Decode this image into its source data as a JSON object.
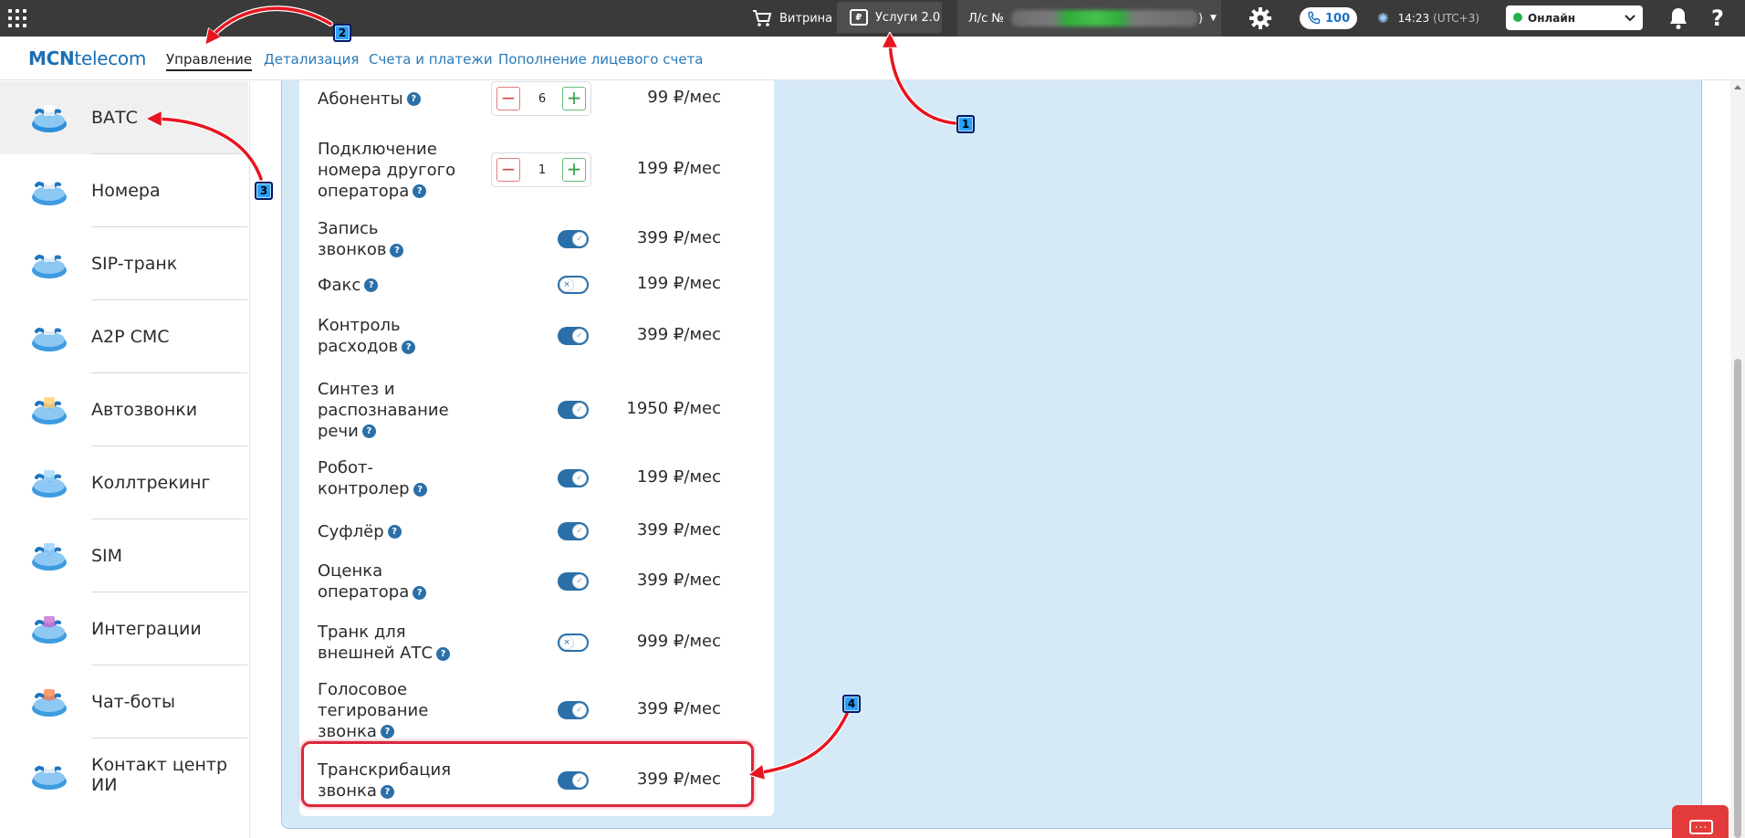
{
  "topbar": {
    "vitrina_label": "Витрина",
    "uslugi_label": "Услуги 2.0",
    "account_prefix": "Л/с №",
    "account_suffix": ")",
    "calls_count": "100",
    "time": "14:23",
    "timezone": "(UTC+3)",
    "status_value": "Онлайн",
    "help_label": "?"
  },
  "nav": {
    "logo_bold": "MCN",
    "logo_rest": "telecom",
    "links": [
      "Управление",
      "Детализация",
      "Счета и платежи",
      "Пополнение лицевого счета"
    ],
    "active_link": "Управление"
  },
  "sidebar": {
    "items": [
      {
        "label": "ВАТС",
        "icon": "vats-icon"
      },
      {
        "label": "Номера",
        "icon": "numbers-icon"
      },
      {
        "label": "SIP-транк",
        "icon": "sip-trunk-icon"
      },
      {
        "label": "A2P СМС",
        "icon": "sms-icon"
      },
      {
        "label": "Автозвонки",
        "icon": "autocall-icon"
      },
      {
        "label": "Коллтрекинг",
        "icon": "calltracking-icon"
      },
      {
        "label": "SIM",
        "icon": "sim-icon"
      },
      {
        "label": "Интеграции",
        "icon": "integrations-icon"
      },
      {
        "label": "Чат-боты",
        "icon": "chatbots-icon"
      },
      {
        "label": "Контакт центр ИИ",
        "icon": "ai-contact-center-icon"
      }
    ],
    "active": "ВАТС"
  },
  "options": [
    {
      "label_lines": [
        "Абоненты"
      ],
      "control": "stepper",
      "value": "6",
      "price": "99 ₽/мес"
    },
    {
      "label_lines": [
        "Подключение",
        "номера другого",
        "оператора"
      ],
      "control": "stepper",
      "value": "1",
      "price": "199 ₽/мес"
    },
    {
      "label_lines": [
        "Запись",
        "звонков"
      ],
      "control": "toggle",
      "state": "on",
      "price": "399 ₽/мес"
    },
    {
      "label_lines": [
        "Факс"
      ],
      "control": "toggle",
      "state": "off",
      "price": "199 ₽/мес"
    },
    {
      "label_lines": [
        "Контроль",
        "расходов"
      ],
      "control": "toggle",
      "state": "on",
      "price": "399 ₽/мес"
    },
    {
      "label_lines": [
        "Синтез и",
        "распознавание",
        "речи"
      ],
      "control": "toggle",
      "state": "on",
      "price": "1950 ₽/мес"
    },
    {
      "label_lines": [
        "Робот-",
        "контролер"
      ],
      "control": "toggle",
      "state": "on",
      "price": "199 ₽/мес"
    },
    {
      "label_lines": [
        "Суфлёр"
      ],
      "control": "toggle",
      "state": "on",
      "price": "399 ₽/мес"
    },
    {
      "label_lines": [
        "Оценка",
        "оператора"
      ],
      "control": "toggle",
      "state": "on",
      "price": "399 ₽/мес"
    },
    {
      "label_lines": [
        "Транк для",
        "внешней АТС"
      ],
      "control": "toggle",
      "state": "off",
      "price": "999 ₽/мес"
    },
    {
      "label_lines": [
        "Голосовое",
        "тегирование",
        "звонка"
      ],
      "control": "toggle",
      "state": "on",
      "price": "399 ₽/мес"
    },
    {
      "label_lines": [
        "Транскрибация",
        "звонка"
      ],
      "control": "toggle",
      "state": "on",
      "price": "399 ₽/мес"
    }
  ],
  "stepper": {
    "minus": "−",
    "plus": "+"
  },
  "help_mark": "?",
  "annotations": {
    "badges": [
      "1",
      "2",
      "3",
      "4"
    ],
    "arrow_color": "#e8141f",
    "badge_color": "#2aa0ff"
  },
  "colors": {
    "accent": "#2a6fa8",
    "topbar": "#3a3a3a",
    "panel": "#d6e9f6",
    "highlight": "#d8283f",
    "online": "#20b24b"
  }
}
